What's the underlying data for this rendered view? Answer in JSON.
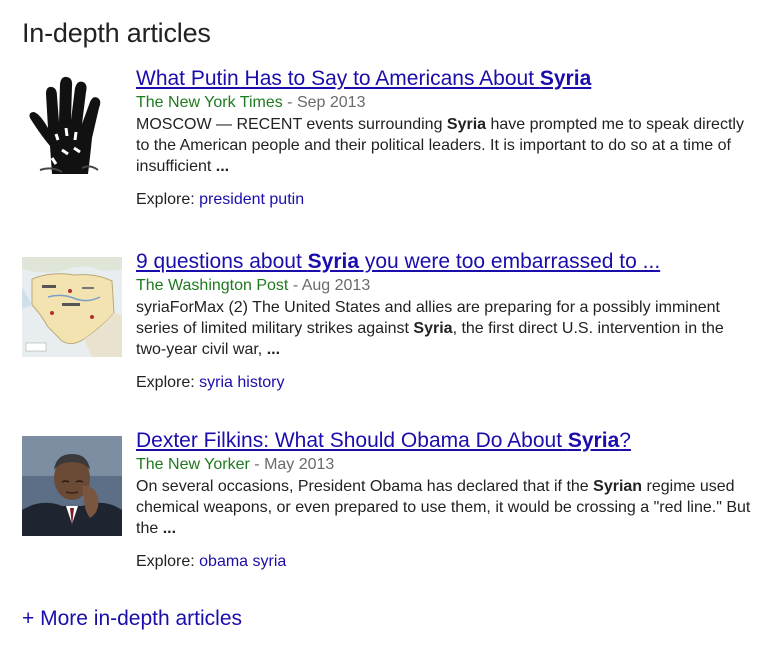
{
  "heading": "In-depth articles",
  "articles": [
    {
      "title_pre": "What Putin Has to Say to Americans About ",
      "title_bold": "Syria",
      "title_post": "",
      "source": "The New York Times",
      "separator": " - ",
      "date": "Sep 2013",
      "snippet_pre": "MOSCOW — RECENT events surrounding ",
      "snippet_bold": "Syria",
      "snippet_post": " have prompted me to speak directly to the American people and their political leaders. It is important to do so at a time of insufficient ",
      "snippet_end": "...",
      "explore_label": "Explore: ",
      "explore_link": "president putin",
      "thumb_icon": "hand-icon"
    },
    {
      "title_pre": "9 questions about ",
      "title_bold": "Syria",
      "title_post": " you were too embarrassed to ...",
      "source": "The Washington Post",
      "separator": " - ",
      "date": "Aug 2013",
      "snippet_pre": "syriaForMax (2) The United States and allies are preparing for a possibly imminent series of limited military strikes against ",
      "snippet_bold": "Syria",
      "snippet_post": ", the first direct U.S. intervention in the two-year civil war, ",
      "snippet_end": "...",
      "explore_label": "Explore: ",
      "explore_link": "syria history",
      "thumb_icon": "map-icon"
    },
    {
      "title_pre": "Dexter Filkins: What Should Obama Do About ",
      "title_bold": "Syria",
      "title_post": "?",
      "source": "The New Yorker",
      "separator": " - ",
      "date": "May 2013",
      "snippet_pre": "On several occasions, President Obama has declared that if the ",
      "snippet_bold": "Syrian",
      "snippet_post": " regime used chemical weapons, or even prepared to use them, it would be crossing a \"red line.\" But the ",
      "snippet_end": "...",
      "explore_label": "Explore: ",
      "explore_link": "obama syria",
      "thumb_icon": "portrait-icon"
    }
  ],
  "more_link": "+ More in-depth articles",
  "colors": {
    "link": "#1a0dab",
    "source": "#1e7a1e",
    "date": "#6a6a6a"
  }
}
